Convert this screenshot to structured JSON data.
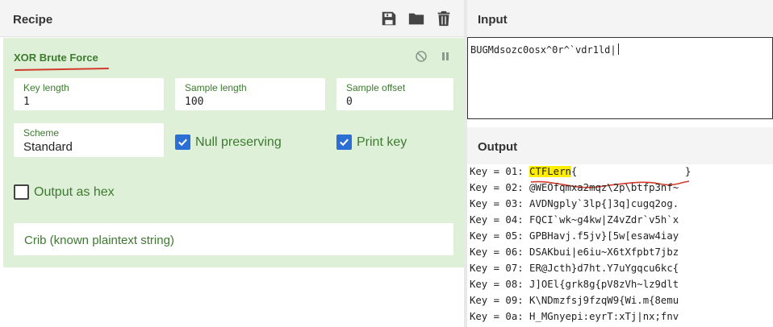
{
  "recipe": {
    "title": "Recipe",
    "icons": [
      "save-icon",
      "folder-icon",
      "trash-icon"
    ],
    "operation": {
      "name": "XOR Brute Force",
      "fields": {
        "key_length": {
          "label": "Key length",
          "value": "1"
        },
        "sample_length": {
          "label": "Sample length",
          "value": "100"
        },
        "sample_offset": {
          "label": "Sample offset",
          "value": "0"
        },
        "scheme": {
          "label": "Scheme",
          "value": "Standard"
        }
      },
      "checkboxes": {
        "null_preserving": {
          "label": "Null preserving",
          "checked": true
        },
        "print_key": {
          "label": "Print key",
          "checked": true
        },
        "output_as_hex": {
          "label": "Output as hex",
          "checked": false
        }
      },
      "crib_placeholder": "Crib (known plaintext string)"
    }
  },
  "input": {
    "title": "Input",
    "value": "BUGMdsozc0osx^0r^`vdr1ld|"
  },
  "output": {
    "title": "Output",
    "rows": [
      {
        "key": "Key = 01: ",
        "highlight": "CTFLern",
        "text": "{",
        "tail": "}"
      },
      {
        "key": "Key = 02: ",
        "highlight": "",
        "text": "@WEOfqmxa2mqz\\2p\\btfp3nf~",
        "tail": ""
      },
      {
        "key": "Key = 03: ",
        "highlight": "",
        "text": "AVDNgply`3lp{]3q]cugq2og.",
        "tail": ""
      },
      {
        "key": "Key = 04: ",
        "highlight": "",
        "text": "FQCI`wk~g4kw|Z4vZdr`v5h`x",
        "tail": ""
      },
      {
        "key": "Key = 05: ",
        "highlight": "",
        "text": "GPBHavj.f5jv}[5w[esaw4iay",
        "tail": ""
      },
      {
        "key": "Key = 06: ",
        "highlight": "",
        "text": "DSAKbui|e6iu~X6tXfpbt7jbz",
        "tail": ""
      },
      {
        "key": "Key = 07: ",
        "highlight": "",
        "text": "ER@Jcth}d7ht.Y7uYgqcu6kc{",
        "tail": ""
      },
      {
        "key": "Key = 08: ",
        "highlight": "",
        "text": "J]OEl{grk8g{pV8zVh~lz9dlt",
        "tail": ""
      },
      {
        "key": "Key = 09: ",
        "highlight": "",
        "text": "K\\NDmzfsj9fzqW9{Wi.m{8emu",
        "tail": ""
      },
      {
        "key": "Key = 0a: ",
        "highlight": "",
        "text": "H_MGnyepi:eyrT:xTj|nx;fnv",
        "tail": ""
      }
    ]
  }
}
